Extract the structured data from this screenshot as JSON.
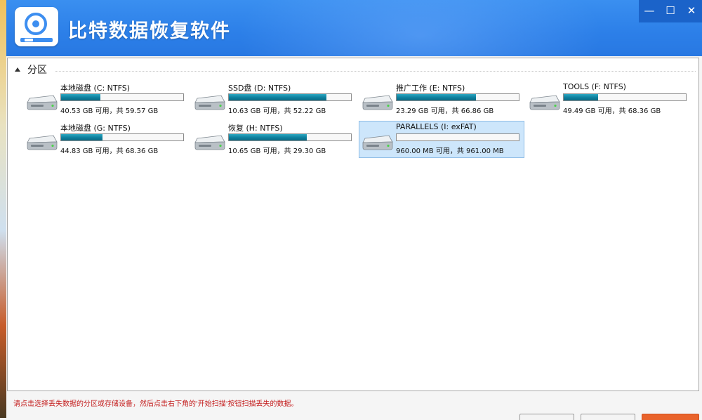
{
  "window": {
    "title": "比特数据恢复软件",
    "controls": {
      "minimize": "—",
      "maximize": "☐",
      "close": "✕"
    }
  },
  "partition_group": {
    "title": "分区"
  },
  "drives": [
    {
      "name": "本地磁盘 (C: NTFS)",
      "info": "40.53 GB 可用，共 59.57 GB",
      "used_fraction": 0.32,
      "selected": false
    },
    {
      "name": "SSD盘 (D: NTFS)",
      "info": "10.63 GB 可用，共 52.22 GB",
      "used_fraction": 0.8,
      "selected": false
    },
    {
      "name": "推广工作 (E: NTFS)",
      "info": "23.29 GB 可用，共 66.86 GB",
      "used_fraction": 0.65,
      "selected": false
    },
    {
      "name": "TOOLS (F: NTFS)",
      "info": "49.49 GB 可用，共 68.36 GB",
      "used_fraction": 0.28,
      "selected": false
    },
    {
      "name": "本地磁盘 (G: NTFS)",
      "info": "44.83 GB 可用，共 68.36 GB",
      "used_fraction": 0.34,
      "selected": false
    },
    {
      "name": "恢复 (H: NTFS)",
      "info": "10.65 GB 可用，共 29.30 GB",
      "used_fraction": 0.64,
      "selected": false
    },
    {
      "name": "PARALLELS (I: exFAT)",
      "info": "960.00 MB 可用，共 961.00 MB",
      "used_fraction": 0.0,
      "selected": true
    }
  ],
  "status_message": "请点击选择丢失数据的分区或存储设备，然后点击右下角的'开始扫描'按钮扫描丢失的数据。",
  "colors": {
    "titlebar": "#2c7fe8",
    "progress": "#0e7f9c",
    "status_text": "#c41e1e",
    "primary_button": "#e9632b"
  }
}
